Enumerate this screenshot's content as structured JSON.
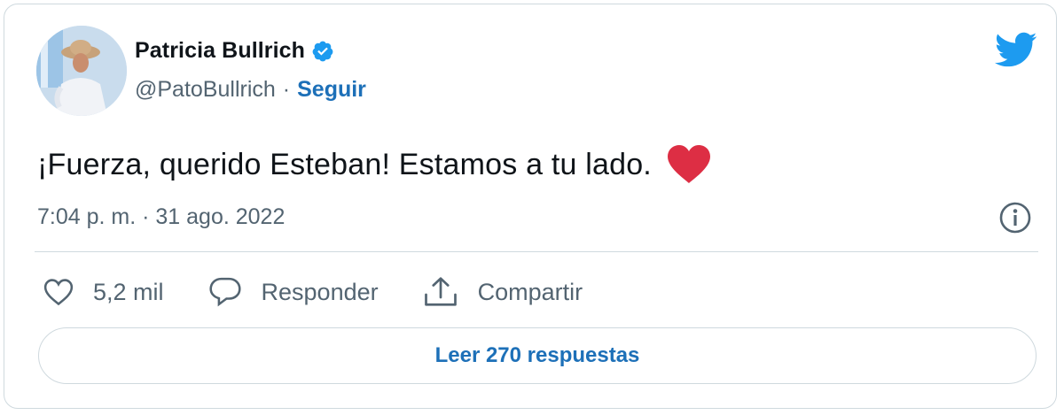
{
  "user": {
    "name": "Patricia Bullrich",
    "handle": "@PatoBullrich",
    "separator": "·",
    "follow_label": "Seguir"
  },
  "tweet": {
    "text": "¡Fuerza, querido Esteban! Estamos a tu lado.",
    "emoji": "red-heart",
    "timestamp": "7:04 p. m. · 31 ago. 2022"
  },
  "actions": {
    "likes_count": "5,2 mil",
    "reply_label": "Responder",
    "share_label": "Compartir"
  },
  "replies_button": "Leer 270 respuestas",
  "icons": {
    "verified": "verified-badge-icon",
    "logo": "twitter-bird-icon",
    "info": "info-icon",
    "like": "heart-outline-icon",
    "reply": "speech-bubble-icon",
    "share": "share-upload-icon"
  },
  "colors": {
    "accent": "#1d9bf0",
    "link": "#1d70b8",
    "heart": "#e0245e",
    "muted": "#536471",
    "border": "#cfd9de"
  }
}
